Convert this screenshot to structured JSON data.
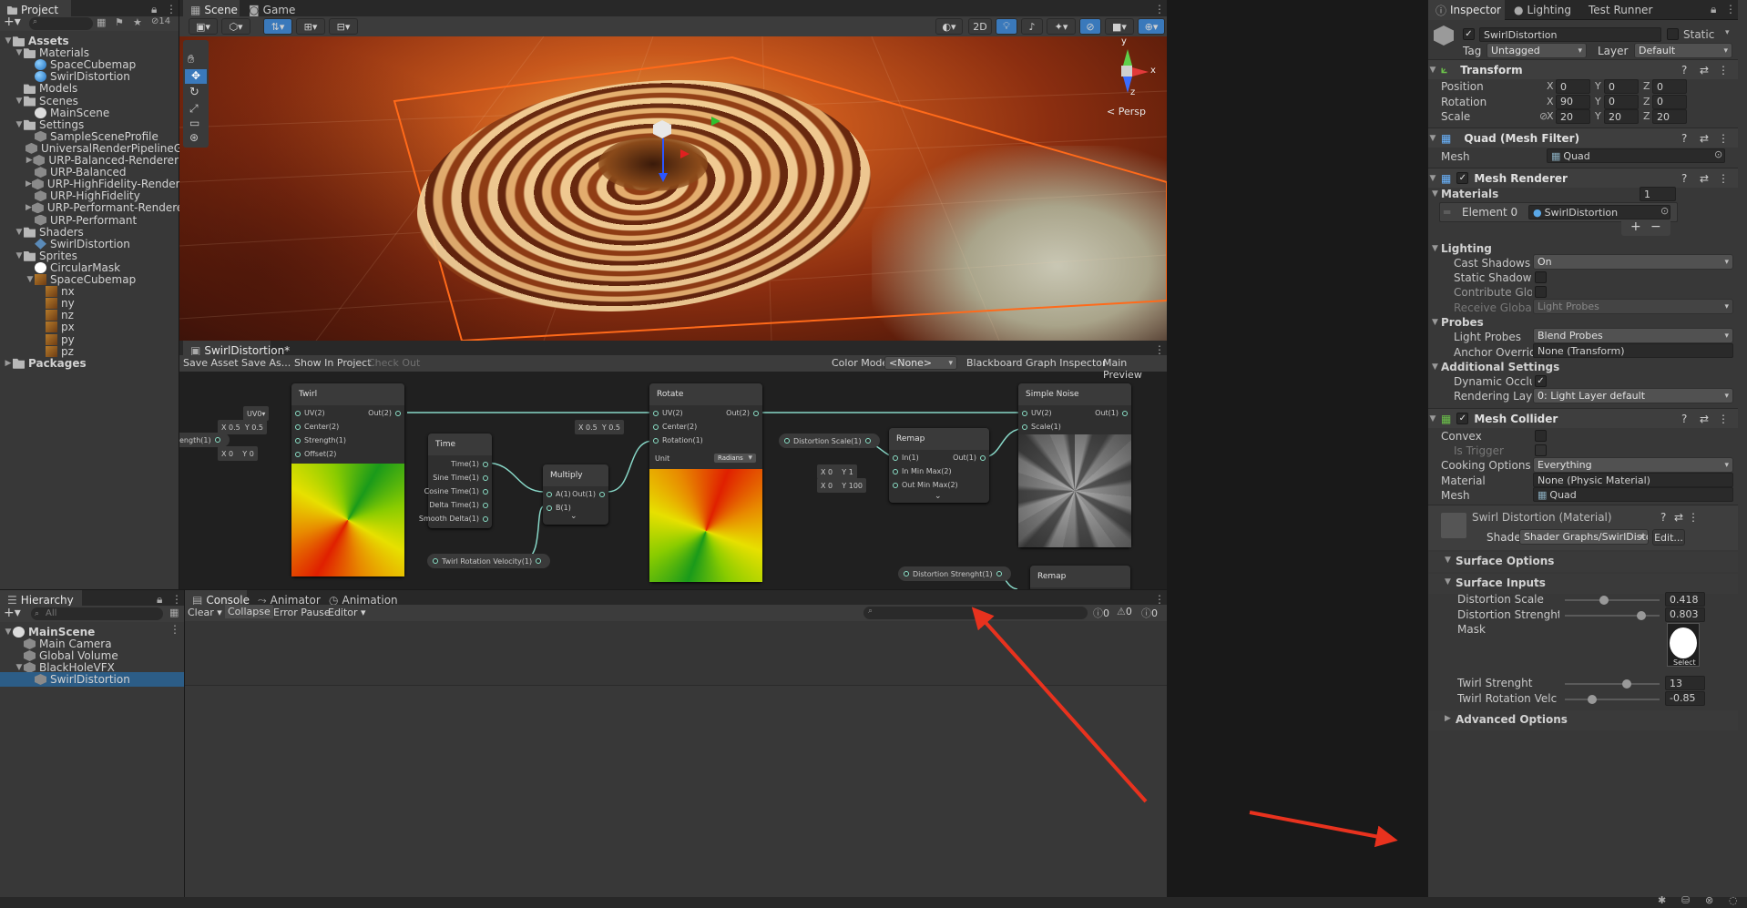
{
  "project": {
    "tab": "Project",
    "count": "14",
    "tree": [
      {
        "label": "Assets",
        "icon": "folder",
        "fold": "▼",
        "bold": true,
        "indent": 0
      },
      {
        "label": "Materials",
        "icon": "folder",
        "fold": "▼",
        "indent": 1
      },
      {
        "label": "SpaceCubemap",
        "icon": "sphere",
        "fold": "",
        "indent": 2
      },
      {
        "label": "SwirlDistortion",
        "icon": "sphere",
        "fold": "",
        "indent": 2
      },
      {
        "label": "Models",
        "icon": "folder",
        "fold": "",
        "indent": 1
      },
      {
        "label": "Scenes",
        "icon": "folder",
        "fold": "▼",
        "indent": 1
      },
      {
        "label": "MainScene",
        "icon": "unity",
        "fold": "",
        "indent": 2
      },
      {
        "label": "Settings",
        "icon": "folder",
        "fold": "▼",
        "indent": 1
      },
      {
        "label": "SampleSceneProfile",
        "icon": "cube",
        "fold": "",
        "indent": 2
      },
      {
        "label": "UniversalRenderPipelineGlobalS",
        "icon": "cube",
        "fold": "",
        "indent": 2
      },
      {
        "label": "URP-Balanced-Renderer",
        "icon": "cube",
        "fold": "▶",
        "indent": 2
      },
      {
        "label": "URP-Balanced",
        "icon": "cube",
        "fold": "",
        "indent": 2
      },
      {
        "label": "URP-HighFidelity-Renderer",
        "icon": "cube",
        "fold": "▶",
        "indent": 2
      },
      {
        "label": "URP-HighFidelity",
        "icon": "cube",
        "fold": "",
        "indent": 2
      },
      {
        "label": "URP-Performant-Renderer",
        "icon": "cube",
        "fold": "▶",
        "indent": 2
      },
      {
        "label": "URP-Performant",
        "icon": "cube",
        "fold": "",
        "indent": 2
      },
      {
        "label": "Shaders",
        "icon": "folder",
        "fold": "▼",
        "indent": 1
      },
      {
        "label": "SwirlDistortion",
        "icon": "shader-i",
        "fold": "",
        "indent": 2
      },
      {
        "label": "Sprites",
        "icon": "folder",
        "fold": "▼",
        "indent": 1
      },
      {
        "label": "CircularMask",
        "icon": "white-c",
        "fold": "",
        "indent": 2
      },
      {
        "label": "SpaceCubemap",
        "icon": "thumb",
        "fold": "▼",
        "indent": 2
      },
      {
        "label": "nx",
        "icon": "thumb",
        "fold": "",
        "indent": 3
      },
      {
        "label": "ny",
        "icon": "thumb",
        "fold": "",
        "indent": 3
      },
      {
        "label": "nz",
        "icon": "thumb",
        "fold": "",
        "indent": 3
      },
      {
        "label": "px",
        "icon": "thumb",
        "fold": "",
        "indent": 3
      },
      {
        "label": "py",
        "icon": "thumb",
        "fold": "",
        "indent": 3
      },
      {
        "label": "pz",
        "icon": "thumb",
        "fold": "",
        "indent": 3
      },
      {
        "label": "Packages",
        "icon": "folder",
        "fold": "▶",
        "bold": true,
        "indent": 0
      }
    ]
  },
  "hierarchy": {
    "tab": "Hierarchy",
    "search_placeholder": "All",
    "tree": [
      {
        "label": "MainScene",
        "icon": "unity",
        "fold": "▼",
        "bold": true,
        "indent": 0
      },
      {
        "label": "Main Camera",
        "icon": "cube",
        "fold": "",
        "indent": 1
      },
      {
        "label": "Global Volume",
        "icon": "cube",
        "fold": "",
        "indent": 1
      },
      {
        "label": "BlackHoleVFX",
        "icon": "cube",
        "fold": "▼",
        "indent": 1
      },
      {
        "label": "SwirlDistortion",
        "icon": "cube",
        "fold": "",
        "indent": 2,
        "selected": true
      }
    ]
  },
  "scene": {
    "tabs": [
      "Scene",
      "Game"
    ],
    "toolbar_2d": "2D",
    "persp_label": "< Persp",
    "gizmo_axes": {
      "x": "x",
      "y": "y",
      "z": "z"
    }
  },
  "graph": {
    "tab": "SwirlDistortion*",
    "toolbar": {
      "save_asset": "Save Asset",
      "save_as": "Save As...",
      "show_in_project": "Show In Project",
      "check_out": "Check Out",
      "color_mode_label": "Color Mode",
      "color_mode_value": "<None>",
      "blackboard": "Blackboard",
      "graph_inspector": "Graph Inspector",
      "main_preview": "Main Preview"
    },
    "nodes": {
      "twirl": {
        "title": "Twirl",
        "in": [
          "UV(2)",
          "Center(2)",
          "Strength(1)",
          "Offset(2)"
        ],
        "out": "Out(2)",
        "uv": "UV0",
        "center_x": "0.5",
        "center_y": "0.5",
        "offset_x": "0",
        "offset_y": "0",
        "strength_pill": "ength(1)"
      },
      "time": {
        "title": "Time",
        "outs": [
          "Time(1)",
          "Sine Time(1)",
          "Cosine Time(1)",
          "Delta Time(1)",
          "Smooth Delta(1)"
        ]
      },
      "multiply": {
        "title": "Multiply",
        "in": [
          "A(1)",
          "B(1)"
        ],
        "out": "Out(1)"
      },
      "rotate": {
        "title": "Rotate",
        "in": [
          "UV(2)",
          "Center(2)",
          "Rotation(1)"
        ],
        "out": "Out(2)",
        "center_x": "0.5",
        "center_y": "0.5",
        "unit_label": "Unit",
        "unit_value": "Radians"
      },
      "remap": {
        "title": "Remap",
        "in": [
          "In(1)",
          "In Min Max(2)",
          "Out Min Max(2)"
        ],
        "out": "Out(1)",
        "in_x": "0",
        "in_y": "1",
        "out_x": "0",
        "out_y": "100"
      },
      "noise": {
        "title": "Simple Noise",
        "in": [
          "UV(2)",
          "Scale(1)"
        ],
        "out": "Out(1)"
      },
      "remap2": {
        "title": "Remap"
      }
    },
    "pills": {
      "twirl_velocity": "Twirl Rotation Velocity(1)",
      "distortion_scale": "Distortion Scale(1)",
      "distortion_strength": "Distortion Strenght(1)"
    },
    "axis_labels": {
      "x": "X",
      "y": "Y"
    }
  },
  "console": {
    "tabs": [
      "Console",
      "Animator",
      "Animation"
    ],
    "toolbar": {
      "clear": "Clear",
      "collapse": "Collapse",
      "error_pause": "Error Pause",
      "editor": "Editor"
    },
    "counts": {
      "info": "0",
      "warn": "0",
      "error": "0"
    }
  },
  "inspector": {
    "tabs": [
      "Inspector",
      "Lighting",
      "Test Runner"
    ],
    "object_name": "SwirlDistortion",
    "static_label": "Static",
    "tag_label": "Tag",
    "tag_value": "Untagged",
    "layer_label": "Layer",
    "layer_value": "Default",
    "transform": {
      "title": "Transform",
      "rows": [
        {
          "label": "Position",
          "x": "0",
          "y": "0",
          "z": "0"
        },
        {
          "label": "Rotation",
          "x": "90",
          "y": "0",
          "z": "0"
        },
        {
          "label": "Scale",
          "x": "20",
          "y": "20",
          "z": "20"
        }
      ]
    },
    "mesh_filter": {
      "title": "Quad (Mesh Filter)",
      "mesh_label": "Mesh",
      "mesh_value": "Quad"
    },
    "mesh_renderer": {
      "title": "Mesh Renderer",
      "materials_label": "Materials",
      "materials_count": "1",
      "element_label": "Element 0",
      "element_value": "SwirlDistortion",
      "lighting_label": "Lighting",
      "cast_shadows_label": "Cast Shadows",
      "cast_shadows_value": "On",
      "static_shadow_label": "Static Shadow Cas",
      "contribute_gi_label": "Contribute Global I",
      "receive_gi_label": "Receive Global Illu",
      "receive_gi_value": "Light Probes",
      "probes_label": "Probes",
      "light_probes_label": "Light Probes",
      "light_probes_value": "Blend Probes",
      "anchor_label": "Anchor Override",
      "anchor_value": "None (Transform)",
      "additional_label": "Additional Settings",
      "dynamic_occ_label": "Dynamic Occlusio",
      "rendering_layer_label": "Rendering Layer M",
      "rendering_layer_value": "0: Light Layer default"
    },
    "mesh_collider": {
      "title": "Mesh Collider",
      "convex_label": "Convex",
      "trigger_label": "Is Trigger",
      "cooking_label": "Cooking Options",
      "cooking_value": "Everything",
      "material_label": "Material",
      "material_value": "None (Physic Material)",
      "mesh_label": "Mesh",
      "mesh_value": "Quad"
    },
    "material": {
      "title": "Swirl Distortion (Material)",
      "shader_label": "Shader",
      "shader_value": "Shader Graphs/SwirlDistortio",
      "edit": "Edit...",
      "surface_options": "Surface Options",
      "surface_inputs": "Surface Inputs",
      "props": [
        {
          "label": "Distortion Scale",
          "value": "0.418",
          "fraction": 0.418
        },
        {
          "label": "Distortion Strenght",
          "value": "0.803",
          "fraction": 0.803
        }
      ],
      "mask_label": "Mask",
      "select_label": "Select",
      "props2": [
        {
          "label": "Twirl Strenght",
          "value": "13",
          "fraction": 0.65
        },
        {
          "label": "Twirl Rotation Velc",
          "value": "-0.85",
          "fraction": 0.29
        }
      ],
      "advanced": "Advanced Options"
    }
  },
  "colors": {
    "accent": "#3a79bb",
    "selection": "#2c5d87",
    "arrow": "#e8321e",
    "scene_outline": "#ff6a1a"
  }
}
